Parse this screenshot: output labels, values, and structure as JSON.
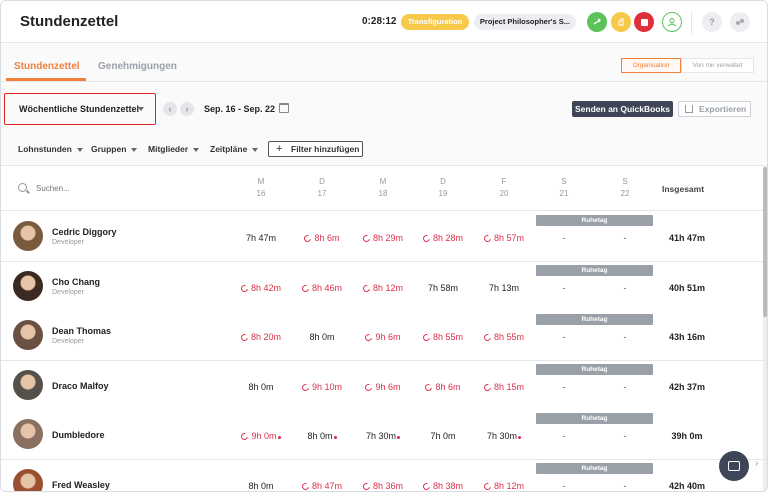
{
  "app": {
    "title": "Stundenzettel"
  },
  "header": {
    "timer": "0:28:12",
    "activity": "Transfiguration",
    "project": "Project Philosopher's S...",
    "colors": {
      "green": "#5cc35a",
      "yellow": "#f7c948",
      "red": "#e0303c",
      "accent": "#f0803c"
    }
  },
  "tabs": [
    {
      "label": "Stundenzettel"
    },
    {
      "label": "Genehmigungen"
    }
  ],
  "scope": {
    "organization": "Organisation",
    "managed": "Von mir verwaltet"
  },
  "toolbar": {
    "view": "Wöchentliche Stundenzettel",
    "daterange": "Sep. 16 - Sep. 22",
    "quickbooks": "Senden an QuickBooks",
    "export": "Exportieren"
  },
  "filters": {
    "pay": "Lohnstunden",
    "groups": "Gruppen",
    "members": "Mitglieder",
    "schedules": "Zeitpläne",
    "add": "Filter hinzufügen"
  },
  "table": {
    "search_placeholder": "Suchen...",
    "total_header": "Insgesamt",
    "days": [
      {
        "letter": "M",
        "num": "16"
      },
      {
        "letter": "D",
        "num": "17"
      },
      {
        "letter": "M",
        "num": "18"
      },
      {
        "letter": "D",
        "num": "19"
      },
      {
        "letter": "F",
        "num": "20"
      },
      {
        "letter": "S",
        "num": "21"
      },
      {
        "letter": "S",
        "num": "22"
      }
    ],
    "rest_label": "Ruhetag",
    "dash": "-",
    "rows": [
      {
        "name": "Cedric Diggory",
        "role": "Developer",
        "total": "41h 47m",
        "cells": [
          {
            "v": "7h 47m"
          },
          {
            "v": "8h 6m",
            "ot": true
          },
          {
            "v": "8h 29m",
            "ot": true
          },
          {
            "v": "8h 28m",
            "ot": true
          },
          {
            "v": "8h 57m",
            "ot": true
          }
        ]
      },
      {
        "name": "Cho Chang",
        "role": "Developer",
        "total": "40h 51m",
        "cells": [
          {
            "v": "8h 42m",
            "ot": true
          },
          {
            "v": "8h 46m",
            "ot": true
          },
          {
            "v": "8h 12m",
            "ot": true
          },
          {
            "v": "7h 58m"
          },
          {
            "v": "7h 13m"
          }
        ]
      },
      {
        "name": "Dean Thomas",
        "role": "Developer",
        "total": "43h 16m",
        "cells": [
          {
            "v": "8h 20m",
            "ot": true
          },
          {
            "v": "8h 0m"
          },
          {
            "v": "9h 6m",
            "ot": true
          },
          {
            "v": "8h 55m",
            "ot": true
          },
          {
            "v": "8h 55m",
            "ot": true
          }
        ]
      },
      {
        "name": "Draco Malfoy",
        "role": "",
        "total": "42h 37m",
        "cells": [
          {
            "v": "8h 0m"
          },
          {
            "v": "9h 10m",
            "ot": true
          },
          {
            "v": "9h 6m",
            "ot": true
          },
          {
            "v": "8h 6m",
            "ot": true
          },
          {
            "v": "8h 15m",
            "ot": true
          }
        ]
      },
      {
        "name": "Dumbledore",
        "role": "",
        "total": "39h 0m",
        "cells": [
          {
            "v": "9h 0m",
            "ot": true,
            "dot": true
          },
          {
            "v": "8h 0m",
            "dot": true
          },
          {
            "v": "7h 30m",
            "dot": true
          },
          {
            "v": "7h 0m"
          },
          {
            "v": "7h 30m",
            "dot": true
          }
        ]
      },
      {
        "name": "Fred Weasley",
        "role": "",
        "total": "42h 40m",
        "cells": [
          {
            "v": "8h 0m"
          },
          {
            "v": "8h 47m",
            "ot": true
          },
          {
            "v": "8h 36m",
            "ot": true
          },
          {
            "v": "8h 38m",
            "ot": true
          },
          {
            "v": "8h 12m",
            "ot": true
          }
        ]
      }
    ]
  }
}
